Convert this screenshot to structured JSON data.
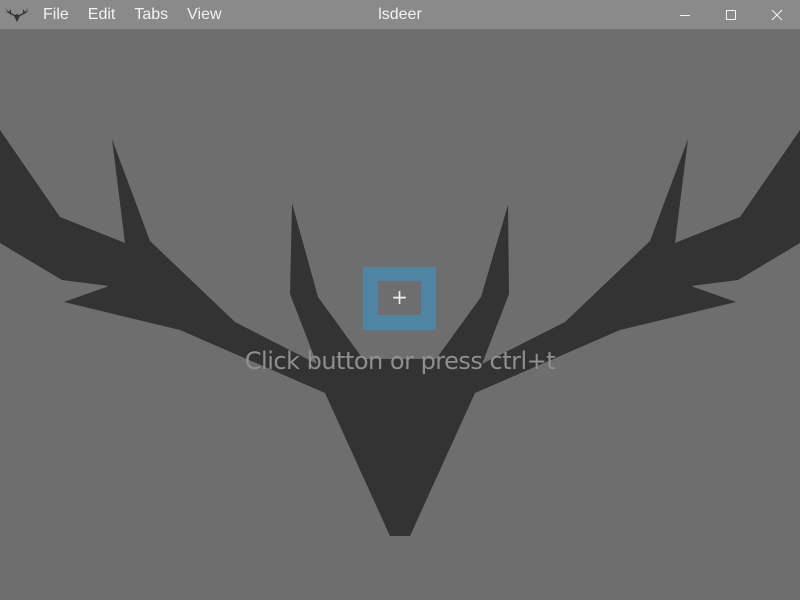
{
  "window": {
    "title": "lsdeer",
    "controls": {
      "minimize_icon": "minimize-icon",
      "maximize_icon": "maximize-icon",
      "close_icon": "close-icon"
    }
  },
  "menu": {
    "items": [
      {
        "label": "File"
      },
      {
        "label": "Edit"
      },
      {
        "label": "Tabs"
      },
      {
        "label": "View"
      }
    ]
  },
  "main": {
    "add_button_label": "+",
    "hint": "Click button or press ctrl+t",
    "background_icon": "deer-antlers-logo"
  },
  "colors": {
    "titlebar": "#8a8a8a",
    "background": "#6e6e6e",
    "deer": "#333333",
    "accent": "#4d85a3",
    "hint_text": "#8f8f8f"
  }
}
